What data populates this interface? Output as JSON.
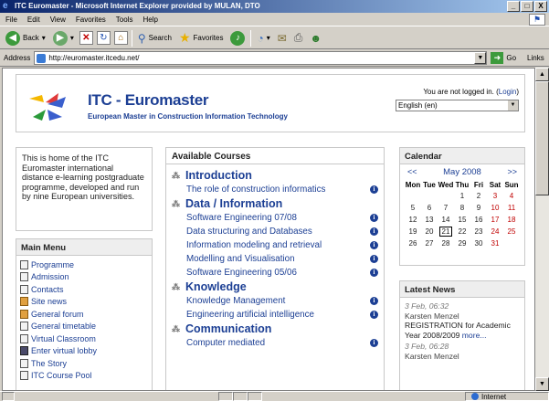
{
  "window": {
    "title": "ITC Euromaster - Microsoft Internet Explorer provided by MULAN, DTO",
    "controls": [
      "_",
      "□",
      "X"
    ]
  },
  "menu": [
    "File",
    "Edit",
    "View",
    "Favorites",
    "Tools",
    "Help"
  ],
  "toolbar": {
    "back_label": "Back",
    "search_label": "Search",
    "favorites_label": "Favorites"
  },
  "addressbar": {
    "label": "Address",
    "url": "http://euromaster.itcedu.net/",
    "go_label": "Go",
    "links_label": "Links"
  },
  "header": {
    "title": "ITC - Euromaster",
    "subtitle": "European Master in Construction Information Technology",
    "login_text": "You are not logged in. (",
    "login_link": "Login",
    "login_close": ")",
    "language": "English (en)"
  },
  "intro": {
    "text": "This is home of the ITC Euromaster international distance e-learning postgraduate programme, developed and run by nine European universities."
  },
  "main_menu": {
    "title": "Main Menu",
    "items": [
      {
        "label": "Programme",
        "icon": "document-icon"
      },
      {
        "label": "Admission",
        "icon": "document-icon"
      },
      {
        "label": "Contacts",
        "icon": "document-icon"
      },
      {
        "label": "Site news",
        "icon": "forum-icon"
      },
      {
        "label": "General forum",
        "icon": "forum-icon"
      },
      {
        "label": "General timetable",
        "icon": "document-icon"
      },
      {
        "label": "Virtual Classroom",
        "icon": "document-icon"
      },
      {
        "label": "Enter virtual lobby",
        "icon": "lobby-icon"
      },
      {
        "label": "The Story",
        "icon": "document-icon"
      },
      {
        "label": "ITC Course Pool",
        "icon": "document-icon"
      }
    ]
  },
  "courses": {
    "title": "Available Courses",
    "categories": [
      {
        "name": "Introduction",
        "courses": [
          "The role of construction informatics"
        ]
      },
      {
        "name": "Data / Information",
        "courses": [
          "Software Engineering 07/08",
          "Data structuring and Databases",
          "Information modeling and retrieval",
          "Modelling and Visualisation",
          "Software Engineering 05/06"
        ]
      },
      {
        "name": "Knowledge",
        "courses": [
          "Knowledge Management",
          "Engineering artificial intelligence"
        ]
      },
      {
        "name": "Communication",
        "courses": [
          "Computer mediated"
        ]
      }
    ]
  },
  "calendar": {
    "title": "Calendar",
    "prev": "<<",
    "next": ">>",
    "month": "May 2008",
    "weekdays": [
      "Mon",
      "Tue",
      "Wed",
      "Thu",
      "Fri",
      "Sat",
      "Sun"
    ],
    "weeks": [
      [
        "",
        "",
        "",
        "1",
        "2",
        "3",
        "4"
      ],
      [
        "5",
        "6",
        "7",
        "8",
        "9",
        "10",
        "11"
      ],
      [
        "12",
        "13",
        "14",
        "15",
        "16",
        "17",
        "18"
      ],
      [
        "19",
        "20",
        "21",
        "22",
        "23",
        "24",
        "25"
      ],
      [
        "26",
        "27",
        "28",
        "29",
        "30",
        "31",
        ""
      ]
    ],
    "today": "21",
    "weekend_color": "#c00000"
  },
  "news": {
    "title": "Latest News",
    "items": [
      {
        "date": "3 Feb, 06:32",
        "author": "Karsten Menzel",
        "text": "REGISTRATION for Academic Year 2008/2009",
        "more": "more..."
      },
      {
        "date": "3 Feb, 06:28",
        "author": "Karsten Menzel",
        "text": "",
        "more": ""
      }
    ]
  },
  "status": {
    "zone": "Internet"
  },
  "colors": {
    "link": "#1c3f94",
    "titlebar_start": "#0a246a",
    "titlebar_end": "#a6caf0"
  }
}
